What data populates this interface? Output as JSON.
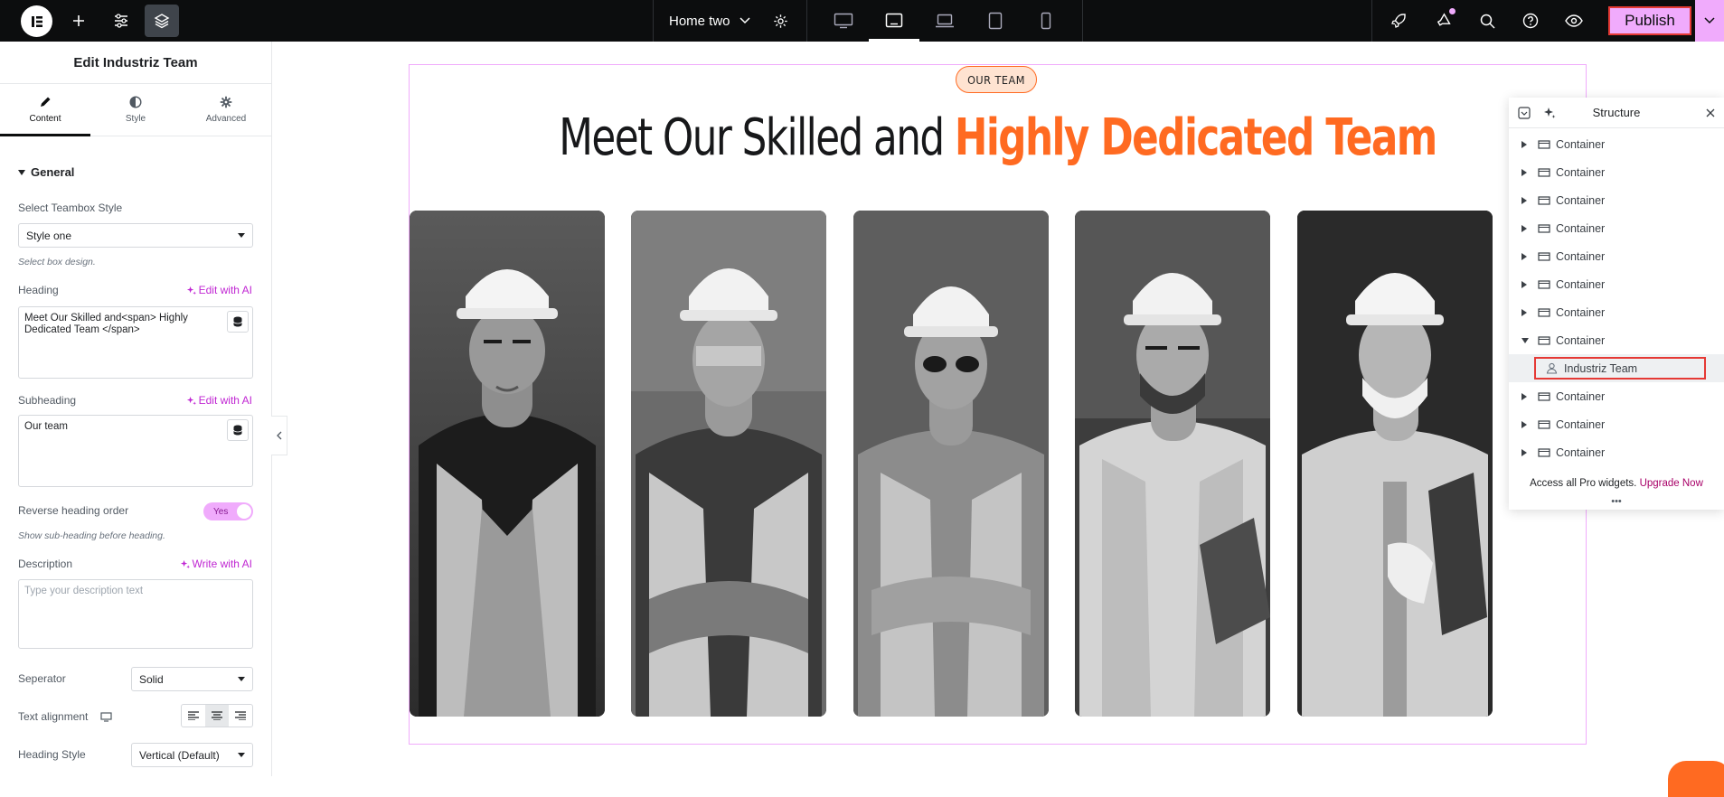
{
  "topbar": {
    "page_title": "Home two",
    "publish_label": "Publish",
    "accent": "#f0abfc"
  },
  "panel": {
    "title": "Edit Industriz Team",
    "tabs": [
      {
        "label": "Content",
        "icon": "pencil-icon"
      },
      {
        "label": "Style",
        "icon": "half-circle-icon"
      },
      {
        "label": "Advanced",
        "icon": "gear-icon"
      }
    ],
    "section": "General",
    "teambox_style": {
      "label": "Select Teambox Style",
      "value": "Style one",
      "hint": "Select box design."
    },
    "heading": {
      "label": "Heading",
      "ai_label": "Edit with AI",
      "value": "Meet Our Skilled and<span> Highly Dedicated Team </span>"
    },
    "subheading": {
      "label": "Subheading",
      "ai_label": "Edit with AI",
      "value": "Our team"
    },
    "reverse": {
      "label": "Reverse heading order",
      "toggle": "Yes",
      "hint": "Show sub-heading before heading."
    },
    "description": {
      "label": "Description",
      "ai_label": "Write with AI",
      "placeholder": "Type your description text"
    },
    "separator": {
      "label": "Seperator",
      "value": "Solid"
    },
    "text_alignment": {
      "label": "Text alignment"
    },
    "heading_style": {
      "label": "Heading Style",
      "value": "Vertical (Default)"
    }
  },
  "canvas": {
    "badge": "OUR TEAM",
    "headline_plain": "Meet Our Skilled and ",
    "headline_highlight": "Highly Dedicated Team",
    "highlight_color": "#ff6a21",
    "photos": [
      "team-member-1",
      "team-member-2",
      "team-member-3",
      "team-member-4",
      "team-member-5"
    ]
  },
  "structure": {
    "title": "Structure",
    "items": [
      {
        "label": "Container",
        "expanded": false
      },
      {
        "label": "Container",
        "expanded": false
      },
      {
        "label": "Container",
        "expanded": false
      },
      {
        "label": "Container",
        "expanded": false
      },
      {
        "label": "Container",
        "expanded": false
      },
      {
        "label": "Container",
        "expanded": false
      },
      {
        "label": "Container",
        "expanded": false
      },
      {
        "label": "Container",
        "expanded": true
      },
      {
        "label": "Industriz Team",
        "child": true,
        "selected": true
      },
      {
        "label": "Container",
        "expanded": false
      },
      {
        "label": "Container",
        "expanded": false
      },
      {
        "label": "Container",
        "expanded": false
      }
    ],
    "pro_text": "Access all Pro widgets.",
    "pro_link": "Upgrade Now"
  }
}
